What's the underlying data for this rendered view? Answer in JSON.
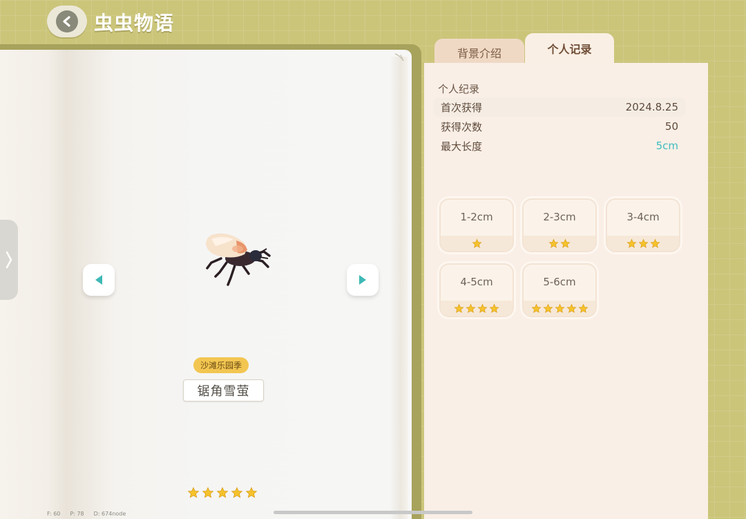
{
  "header": {
    "title": "虫虫物语"
  },
  "tabs": [
    {
      "label": "背景介绍",
      "active": false
    },
    {
      "label": "个人记录",
      "active": true
    }
  ],
  "insect": {
    "season_badge": "沙滩乐园季",
    "name": "锯角雪萤",
    "rarity_stars": 5
  },
  "record": {
    "section_title": "个人纪录",
    "rows": [
      {
        "label": "首次获得",
        "value": "2024.8.25"
      },
      {
        "label": "获得次数",
        "value": "50"
      },
      {
        "label": "最大长度",
        "value": "5cm"
      }
    ]
  },
  "size_cards": [
    {
      "label": "1-2cm",
      "stars": 1
    },
    {
      "label": "2-3cm",
      "stars": 2
    },
    {
      "label": "3-4cm",
      "stars": 3
    },
    {
      "label": "4-5cm",
      "stars": 4
    },
    {
      "label": "5-6cm",
      "stars": 5
    }
  ],
  "debug": {
    "f": "F: 60",
    "p": "P: 78",
    "d": "D: 674node"
  },
  "colors": {
    "background": "#cbc57a",
    "accent_value": "#3fbcc0",
    "badge": "#f2c651",
    "star": "#f5c22c"
  }
}
